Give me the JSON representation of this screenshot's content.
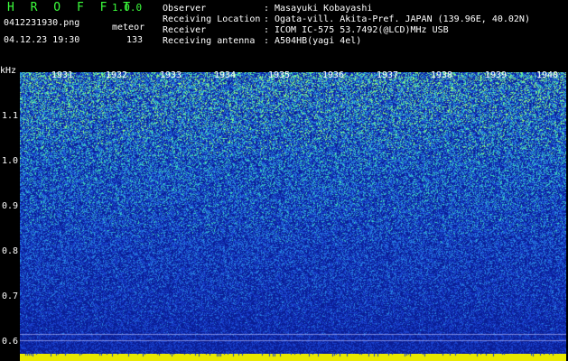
{
  "header": {
    "app_title": "H R O F F T",
    "app_version": "1.0.0",
    "file_name": "0412231930.png",
    "mode": "meteor",
    "datetime": "04.12.23 19:30",
    "count": "133"
  },
  "info": [
    {
      "label": "Observer",
      "value": "Masayuki Kobayashi"
    },
    {
      "label": "Receiving Location",
      "value": "Ogata-vill. Akita-Pref. JAPAN (139.96E, 40.02N)"
    },
    {
      "label": "Receiver",
      "value": "ICOM IC-575 53.7492(@LCD)MHz USB"
    },
    {
      "label": "Receiving antenna",
      "value": "A504HB(yagi 4el)"
    }
  ],
  "chart_data": {
    "type": "heatmap",
    "ylabel": "kHz",
    "y_ticks": [
      "1.1",
      "1.0",
      "0.9",
      "0.8",
      "0.7",
      "0.6"
    ],
    "x_ticks": [
      "1931",
      "1932",
      "1933",
      "1934",
      "1935",
      "1936",
      "1937",
      "1938",
      "1939",
      "1940"
    ],
    "ylim": [
      0.6,
      1.15
    ],
    "colors": {
      "background": "#0b2aa8",
      "noise_low": "#1a3fd0",
      "noise_mid": "#2e7fe0",
      "noise_high": "#3fd8c0",
      "meteor": "#9cff7a",
      "band": "#e8e800"
    }
  }
}
